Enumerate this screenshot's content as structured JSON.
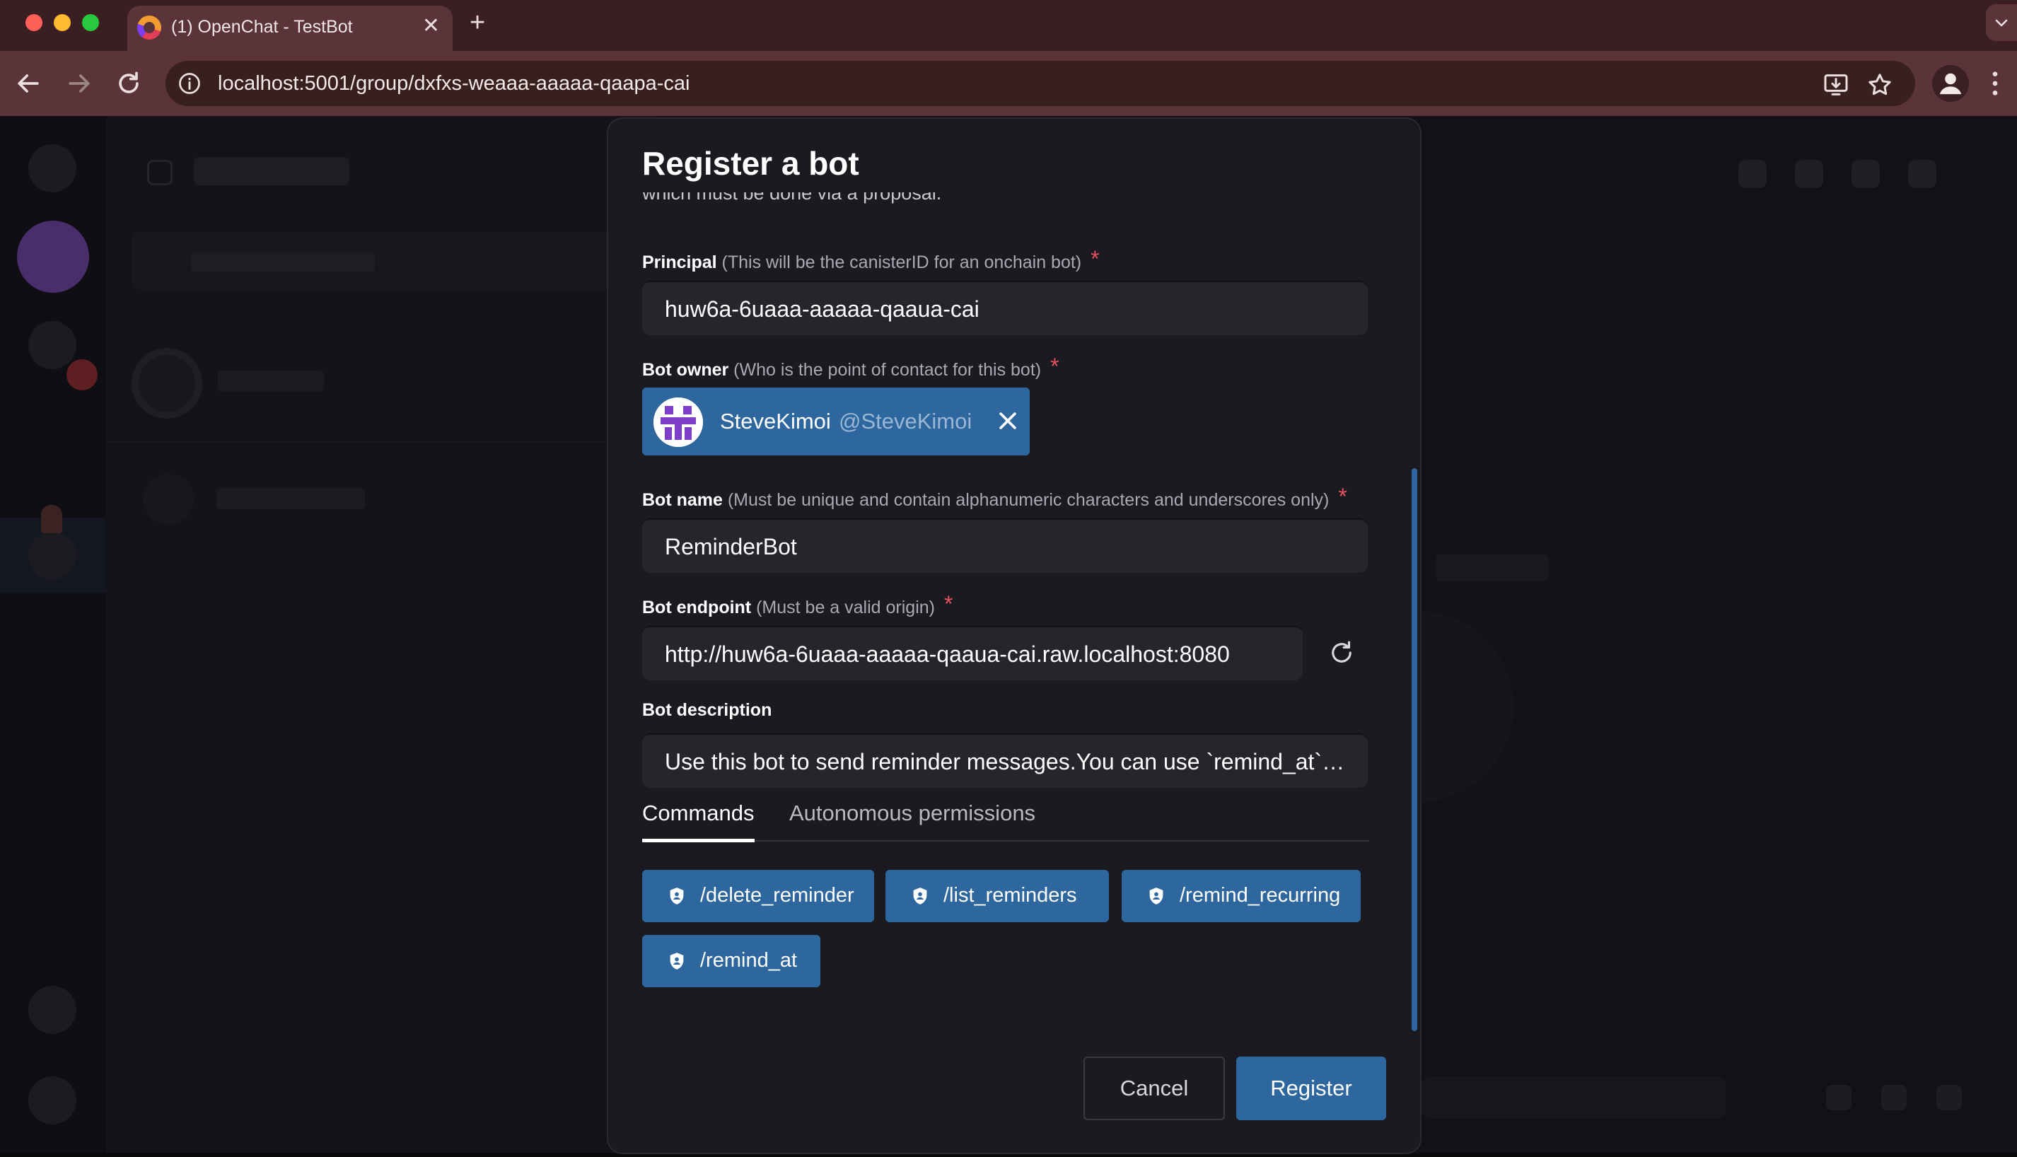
{
  "browser": {
    "tab_title": "(1) OpenChat - TestBot",
    "url": "localhost:5001/group/dxfxs-weaaa-aaaaa-qaapa-cai"
  },
  "modal": {
    "title": "Register a bot",
    "cut_text": "which must be done via a proposal.",
    "principal": {
      "label": "Principal",
      "hint": "(This will be the canisterID for an onchain bot)",
      "required": "*",
      "value": "huw6a-6uaaa-aaaaa-qaaua-cai"
    },
    "owner": {
      "label": "Bot owner",
      "hint": "(Who is the point of contact for this bot)",
      "required": "*",
      "name": "SteveKimoi",
      "handle": "@SteveKimoi"
    },
    "bot_name": {
      "label": "Bot name",
      "hint": "(Must be unique and contain alphanumeric characters and underscores only)",
      "required": "*",
      "value": "ReminderBot"
    },
    "endpoint": {
      "label": "Bot endpoint",
      "hint": "(Must be a valid origin)",
      "required": "*",
      "value": "http://huw6a-6uaaa-aaaaa-qaaua-cai.raw.localhost:8080"
    },
    "description": {
      "label": "Bot description",
      "value": "Use this bot to send reminder messages.You can use `remind_at` to set a reminder"
    },
    "tabs": [
      {
        "label": "Commands",
        "active": true
      },
      {
        "label": "Autonomous permissions",
        "active": false
      }
    ],
    "commands": [
      "/delete_reminder",
      "/list_reminders",
      "/remind_recurring",
      "/remind_at"
    ],
    "cancel_label": "Cancel",
    "register_label": "Register"
  },
  "colors": {
    "accent": "#2e679e",
    "modal_bg": "#1b1a21",
    "input_bg": "#26252c",
    "required": "#e8525f",
    "tab_strip": "#3a1f22",
    "toolbar": "#5a3438"
  },
  "icons": [
    "back-arrow-icon",
    "forward-arrow-icon",
    "reload-icon",
    "site-info-icon",
    "install-app-icon",
    "bookmark-star-icon",
    "profile-icon",
    "more-icon",
    "close-icon",
    "refresh-icon",
    "shield-icon"
  ]
}
